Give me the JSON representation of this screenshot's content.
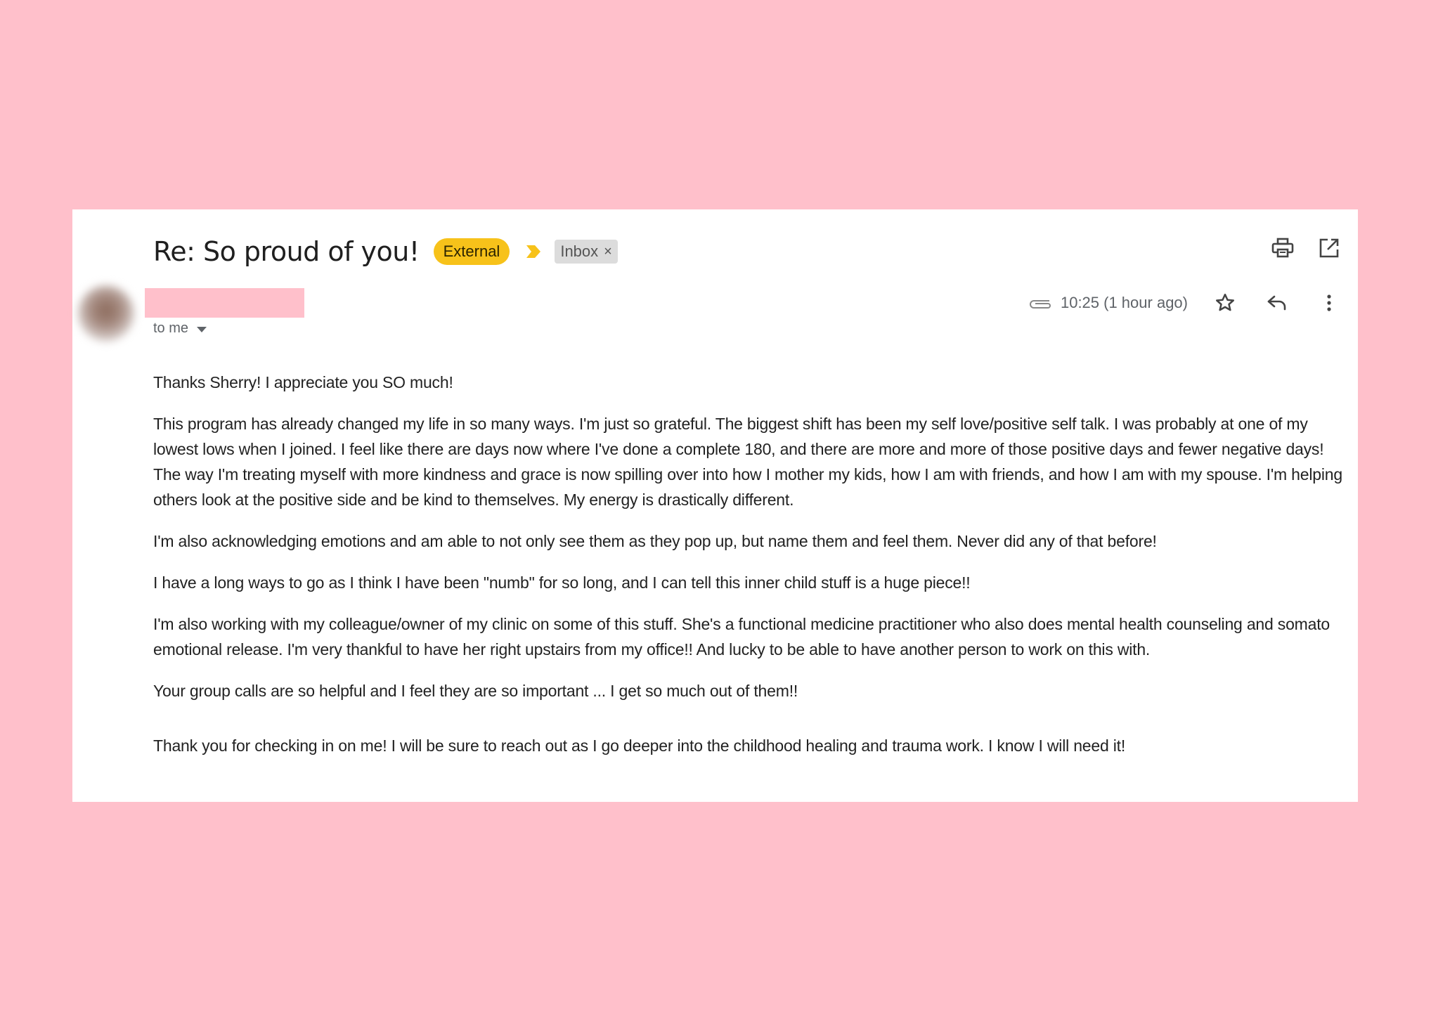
{
  "email": {
    "subject": "Re: So proud of you!",
    "labels": {
      "external": "External",
      "inbox": "Inbox",
      "inbox_remove": "×"
    },
    "recipient": "to me",
    "timestamp": "10:25 (1 hour ago)",
    "icons": {
      "print": "print-icon",
      "open_new_window": "open-in-new-window-icon",
      "attachment": "paperclip-icon",
      "star": "star-icon",
      "reply": "reply-icon",
      "more": "more-vertical-icon",
      "importance": "importance-marker-icon"
    },
    "colors": {
      "background": "#ffc0cb",
      "external_badge": "#f7c21a",
      "inbox_badge": "#dcdcdc",
      "importance_marker": "#f7c21a"
    },
    "body": [
      "Thanks Sherry! I appreciate you SO much!",
      "This program has already changed my life in so many ways. I'm just so grateful. The biggest shift has been my self love/positive self talk. I was probably at one of my lowest lows when I joined. I feel like there are days now where I've done a complete 180, and there are more and more of those positive days and fewer negative days! The way I'm treating myself with more kindness and grace is now spilling over into how I mother my kids, how I am with friends, and how I am with my spouse. I'm helping others look at the positive side and be kind to themselves. My energy is drastically different.",
      "I'm also acknowledging emotions and am able to not only see them as they pop up, but name them and feel them. Never did any of that before!",
      "I have a long ways to go as I think I have been \"numb\" for so long, and I can tell this inner child stuff is a huge piece!!",
      "I'm also working with my colleague/owner of my clinic on some of this stuff. She's a functional medicine practitioner who also does mental health counseling and somato emotional release. I'm very thankful to have her right upstairs from my office!! And lucky to be able to have another person to work on this with.",
      "Your group calls are so helpful and I feel they are so important ... I get so much out of them!!",
      "Thank you for checking in on me! I will be sure to reach out as I go deeper into the childhood healing and trauma work. I know I will need it!"
    ]
  }
}
